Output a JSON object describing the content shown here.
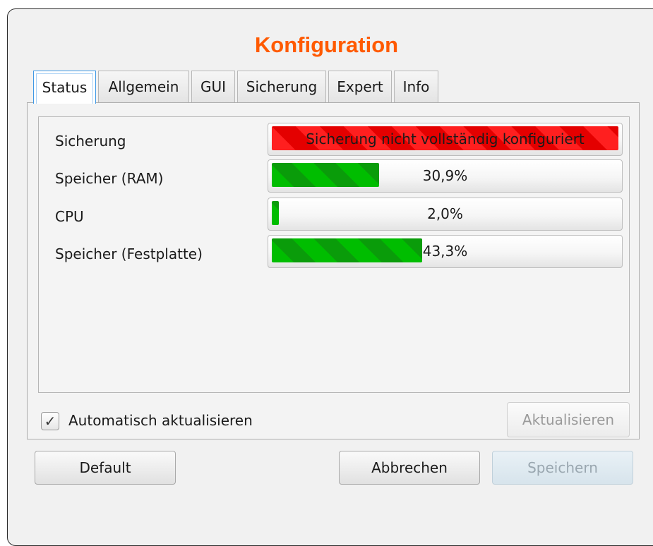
{
  "window": {
    "title": "Konfiguration"
  },
  "tabs": [
    {
      "label": "Status",
      "active": true
    },
    {
      "label": "Allgemein",
      "active": false
    },
    {
      "label": "GUI",
      "active": false
    },
    {
      "label": "Sicherung",
      "active": false
    },
    {
      "label": "Expert",
      "active": false
    },
    {
      "label": "Info",
      "active": false
    }
  ],
  "status": {
    "rows": [
      {
        "label": "Sicherung",
        "bar_text": "Sicherung nicht vollständig konfiguriert",
        "state": "error"
      },
      {
        "label": "Speicher (RAM)",
        "bar_text": "30,9%",
        "value_percent": 30.9
      },
      {
        "label": "CPU",
        "bar_text": "2,0%",
        "value_percent": 2.0
      },
      {
        "label": "Speicher (Festplatte)",
        "bar_text": "43,3%",
        "value_percent": 43.3
      }
    ]
  },
  "auto_refresh": {
    "label": "Automatisch aktualisieren",
    "checked": true
  },
  "buttons": {
    "refresh": "Aktualisieren",
    "default": "Default",
    "cancel": "Abbrechen",
    "save": "Speichern"
  },
  "colors": {
    "title": "#ff5a00",
    "progress_green": "#00bd00",
    "error_red": "#ff1f1f",
    "active_tab_border": "#3f99e5"
  }
}
